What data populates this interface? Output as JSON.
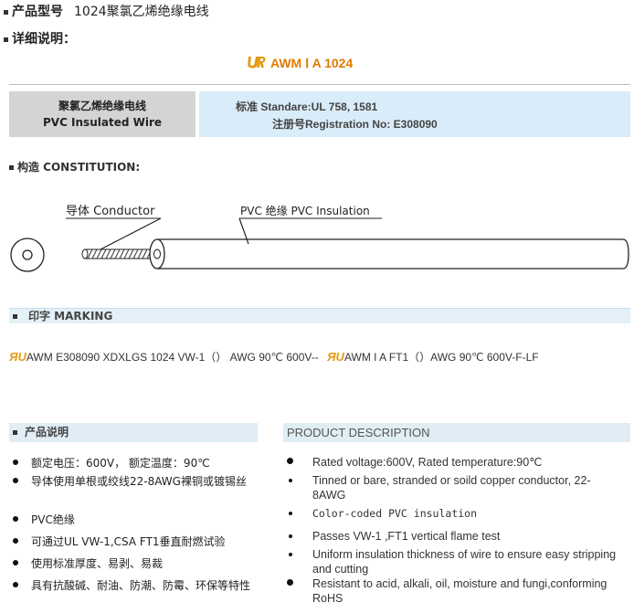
{
  "header": {
    "model_label": "产品型号",
    "model_value": "1024聚氯乙烯绝缘电线",
    "detail_label": "详细说明："
  },
  "logo": {
    "ur_mark": "ᴿᵁ",
    "title": "AWM Ⅰ A 1024"
  },
  "spec": {
    "name_cn": "聚氯乙烯绝缘电线",
    "name_en": "PVC Insulated Wire",
    "standard": "标准  Standare:UL 758, 1581",
    "registration": "注册号Registration No: E308090"
  },
  "constitution": {
    "heading": "构造  CONSTITUTION:",
    "conductor_label": "导体 Conductor",
    "insulation_label": "PVC 绝缘 PVC Insulation"
  },
  "marking": {
    "heading": "印字 MARKING",
    "text_1": "AWM E308090 XDXLGS 1024 VW-1（）  AWG 90℃ 600V--",
    "text_2": "AWM I A FT1（）AWG 90℃ 600V-F-LF"
  },
  "product_cn": {
    "heading": "产品说明",
    "items": [
      "额定电压：600V， 额定温度：90℃",
      "导体使用单根或绞线22-8AWG裸铜或镀锡丝",
      "PVC绝缘",
      "可通过UL VW-1,CSA FT1垂直耐燃试验",
      "使用标准厚度、易剥、易裁",
      "具有抗酸碱、耐油、防潮、防霉、环保等特性"
    ]
  },
  "product_en": {
    "heading": "PRODUCT DESCRIPTION",
    "items": [
      "Rated voltage:600V, Rated temperature:90℃",
      "Tinned or bare, stranded or soild copper conductor, 22-8AWG",
      "Color-coded PVC insulation",
      "Passes VW-1 ,FT1 vertical flame test",
      "Uniform insulation thickness of wire to ensure easy stripping and cutting",
      "Resistant to acid, alkali, oil, moisture and fungi,conforming RoHS"
    ]
  },
  "colors": {
    "accent_orange": "#e07b00",
    "band_blue": "#d9ecf9",
    "band_grey": "#d4d4d4"
  }
}
